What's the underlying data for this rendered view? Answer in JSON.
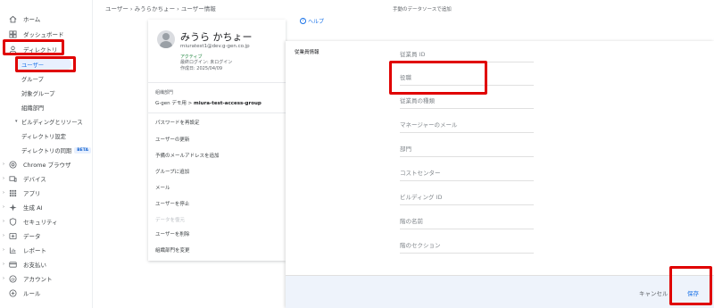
{
  "breadcrumb": "ユーザー  ›  みうらかちょー  ›  ユーザー情報",
  "sidebar": {
    "items": [
      {
        "label": "ホーム",
        "icon": "home-icon"
      },
      {
        "label": "ダッシュボード",
        "icon": "dashboard-icon"
      },
      {
        "label": "ディレクトリ",
        "icon": "person-icon"
      }
    ],
    "sub_items": [
      {
        "label": "ユーザー"
      },
      {
        "label": "グループ"
      },
      {
        "label": "対象グループ"
      },
      {
        "label": "組織部門"
      },
      {
        "label": "ビルディングとリソース"
      },
      {
        "label": "ディレクトリ設定"
      },
      {
        "label": "ディレクトリの同期",
        "badge": "BETA"
      }
    ],
    "bottom_items": [
      {
        "label": "Chrome ブラウザ",
        "icon": "chrome-icon"
      },
      {
        "label": "デバイス",
        "icon": "devices-icon"
      },
      {
        "label": "アプリ",
        "icon": "apps-icon"
      },
      {
        "label": "生成 AI",
        "icon": "sparkle-icon"
      },
      {
        "label": "セキュリティ",
        "icon": "shield-icon"
      },
      {
        "label": "データ",
        "icon": "data-icon"
      },
      {
        "label": "レポート",
        "icon": "chart-icon"
      },
      {
        "label": "お支払い",
        "icon": "billing-icon"
      },
      {
        "label": "アカウント",
        "icon": "account-icon"
      },
      {
        "label": "ルール",
        "icon": "rules-icon"
      }
    ]
  },
  "user": {
    "name": "みうら かちょー",
    "email": "miuratest1@dev.g-gen.co.jp",
    "status": "アクティブ",
    "last_login": "最終ログイン: 未ログイン",
    "created": "作成日: 2025/04/09"
  },
  "org": {
    "label": "組織部門",
    "path_prefix": "G-gen デモ用 > ",
    "path_leaf": "miura-test-access-group"
  },
  "actions": [
    {
      "label": "パスワードを再設定",
      "disabled": false
    },
    {
      "label": "ユーザーの更新",
      "disabled": false
    },
    {
      "label": "予備のメールアドレスを追加",
      "disabled": false
    },
    {
      "label": "グループに追加",
      "disabled": false
    },
    {
      "label": "メール",
      "disabled": false
    },
    {
      "label": "ユーザーを停止",
      "disabled": false
    },
    {
      "label": "データを復元",
      "disabled": true
    },
    {
      "label": "ユーザーを削除",
      "disabled": false
    },
    {
      "label": "組織部門を変更",
      "disabled": false
    }
  ],
  "help_label": "ヘルプ",
  "top_text": "手動のデータソースで追加",
  "panel": {
    "title": "従業員情報",
    "fields": [
      {
        "label": "従業員 ID"
      },
      {
        "label": "役職"
      },
      {
        "label": "従業員の種類"
      },
      {
        "label": "マネージャーのメール"
      },
      {
        "label": "部門"
      },
      {
        "label": "コストセンター"
      },
      {
        "label": "ビルディング ID"
      },
      {
        "label": "階の名前"
      },
      {
        "label": "階のセクション"
      }
    ],
    "cancel_label": "キャンセル",
    "save_label": "保存"
  },
  "colors": {
    "accent": "#1a73e8",
    "highlight": "#e00000",
    "active_bg": "#e8f0fe",
    "status_green": "#188038"
  }
}
